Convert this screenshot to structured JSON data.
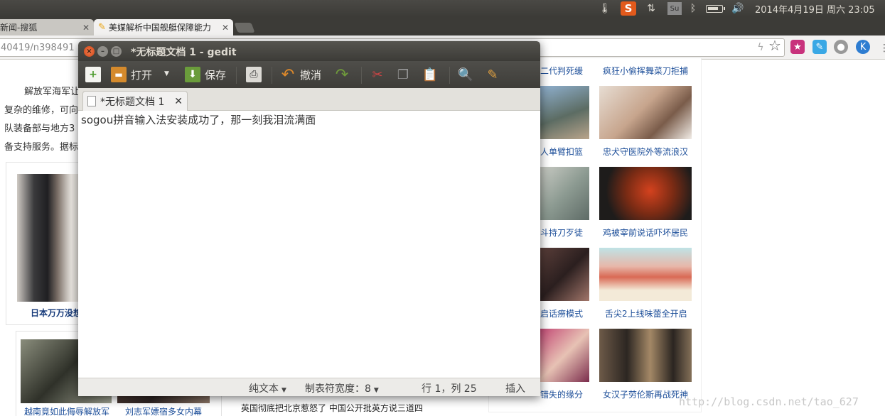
{
  "top_panel": {
    "clock": "2014年4月19日 周六 23:05",
    "sogou_label": "S",
    "su_label": "Su"
  },
  "browser": {
    "tabs": [
      {
        "label": "新闻-搜狐"
      },
      {
        "label": "美媒解析中国舰艇保障能力"
      }
    ],
    "url": "40419/n398491"
  },
  "webpage": {
    "paragraph_lines": [
      "解放军海军让",
      "复杂的维修，可向",
      "队装备部与地方3",
      "备支持服务。据标"
    ],
    "left_caption": "日本万万没想",
    "bottom_left_captions": [
      "越南竟如此侮辱解放军",
      "刘志军嫖宿多女内幕"
    ],
    "bottom_center_caption": "英国彻底把北京惹怒了 中国公开批英方说三道四",
    "right_grid": [
      {
        "left": "二代判死缓",
        "right": "疯狂小偷挥舞菜刀拒捕"
      },
      {
        "left": "人单臂扣篮",
        "right": "忠犬守医院外等流浪汉"
      },
      {
        "left": "斗持刀歹徒",
        "right": "鸡被宰前说话吓坏居民"
      },
      {
        "left": "启话痨模式",
        "right": "舌尖2上线味蕾全开启"
      },
      {
        "left": "错失的缘分",
        "right": "女汉子劳伦斯再战死神"
      }
    ],
    "watermark": "http://blog.csdn.net/tao_627"
  },
  "gedit": {
    "title": "*无标题文档 1 - gedit",
    "toolbar": {
      "open_label": "打开",
      "save_label": "保存",
      "undo_label": "撤消"
    },
    "tab_label": "*无标题文档 1",
    "content": "sogou拼音输入法安装成功了，那一刻我泪流满面",
    "status": {
      "language": "纯文本",
      "tab_width": "制表符宽度：8",
      "position": "行 1，列 25",
      "mode": "插入"
    }
  }
}
